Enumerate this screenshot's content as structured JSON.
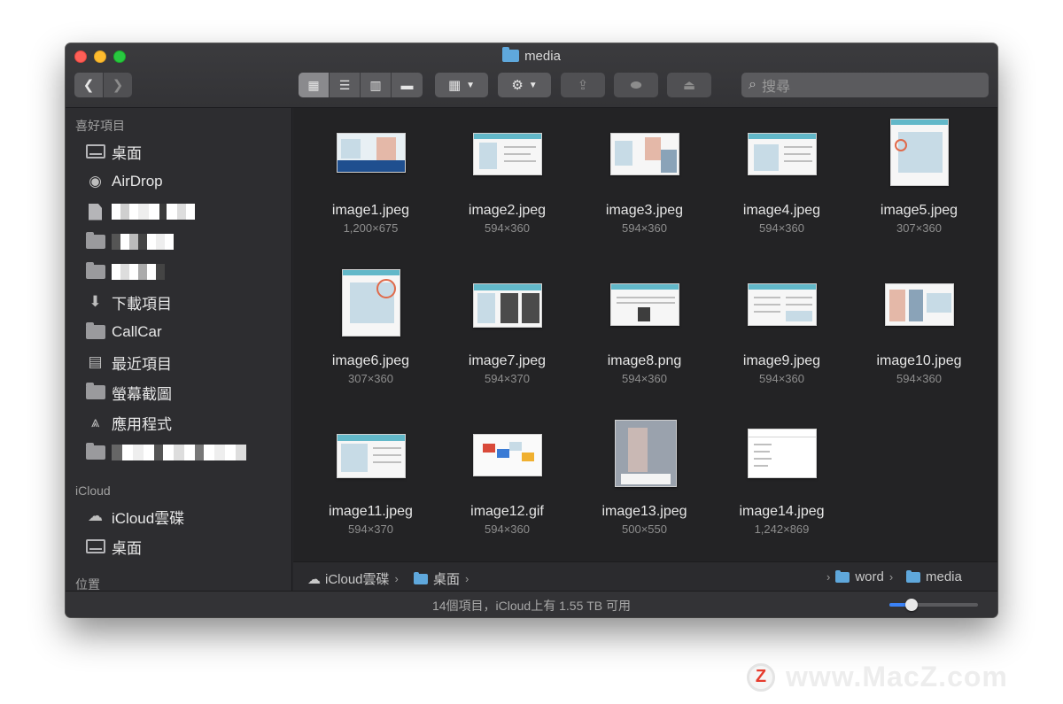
{
  "window": {
    "title": "media",
    "search_placeholder": "搜尋",
    "nav": {
      "back_icon": "chevron-left-icon",
      "forward_icon": "chevron-right-icon"
    }
  },
  "sidebar": {
    "favorites_header": "喜好項目",
    "favorites": [
      {
        "label": "桌面",
        "icon": "desktop-icon"
      },
      {
        "label": "AirDrop",
        "icon": "airdrop-icon"
      },
      {
        "label": "",
        "icon": "document-icon"
      },
      {
        "label": "",
        "icon": "folder-icon"
      },
      {
        "label": "",
        "icon": "folder-icon"
      },
      {
        "label": "下載項目",
        "icon": "download-icon"
      },
      {
        "label": "CallCar",
        "icon": "folder-icon"
      },
      {
        "label": "最近項目",
        "icon": "recents-icon"
      },
      {
        "label": "螢幕截圖",
        "icon": "folder-icon"
      },
      {
        "label": "應用程式",
        "icon": "applications-icon"
      },
      {
        "label": "",
        "icon": "folder-icon"
      }
    ],
    "icloud_header": "iCloud",
    "icloud": [
      {
        "label": "iCloud雲碟",
        "icon": "cloud-icon"
      },
      {
        "label": "桌面",
        "icon": "desktop-icon"
      }
    ],
    "locations_header": "位置"
  },
  "files": [
    {
      "name": "image1.jpeg",
      "size": "1,200×675"
    },
    {
      "name": "image2.jpeg",
      "size": "594×360"
    },
    {
      "name": "image3.jpeg",
      "size": "594×360"
    },
    {
      "name": "image4.jpeg",
      "size": "594×360"
    },
    {
      "name": "image5.jpeg",
      "size": "307×360"
    },
    {
      "name": "image6.jpeg",
      "size": "307×360"
    },
    {
      "name": "image7.jpeg",
      "size": "594×370"
    },
    {
      "name": "image8.png",
      "size": "594×360"
    },
    {
      "name": "image9.jpeg",
      "size": "594×360"
    },
    {
      "name": "image10.jpeg",
      "size": "594×360"
    },
    {
      "name": "image11.jpeg",
      "size": "594×370"
    },
    {
      "name": "image12.gif",
      "size": "594×360"
    },
    {
      "name": "image13.jpeg",
      "size": "500×550"
    },
    {
      "name": "image14.jpeg",
      "size": "1,242×869"
    }
  ],
  "pathbar": {
    "items": [
      "iCloud雲碟",
      "桌面",
      "word",
      "media"
    ]
  },
  "status": {
    "text": "14個項目，iCloud上有 1.55 TB 可用",
    "zoom_fraction": 0.25
  },
  "watermark": {
    "logo": "Z",
    "text": "www.MacZ.com"
  },
  "colors": {
    "folder_blue": "#5fa8dc",
    "accent": "#3b82f6",
    "close": "#fe5f57",
    "minimize": "#febc2e",
    "maximize": "#28c840"
  }
}
